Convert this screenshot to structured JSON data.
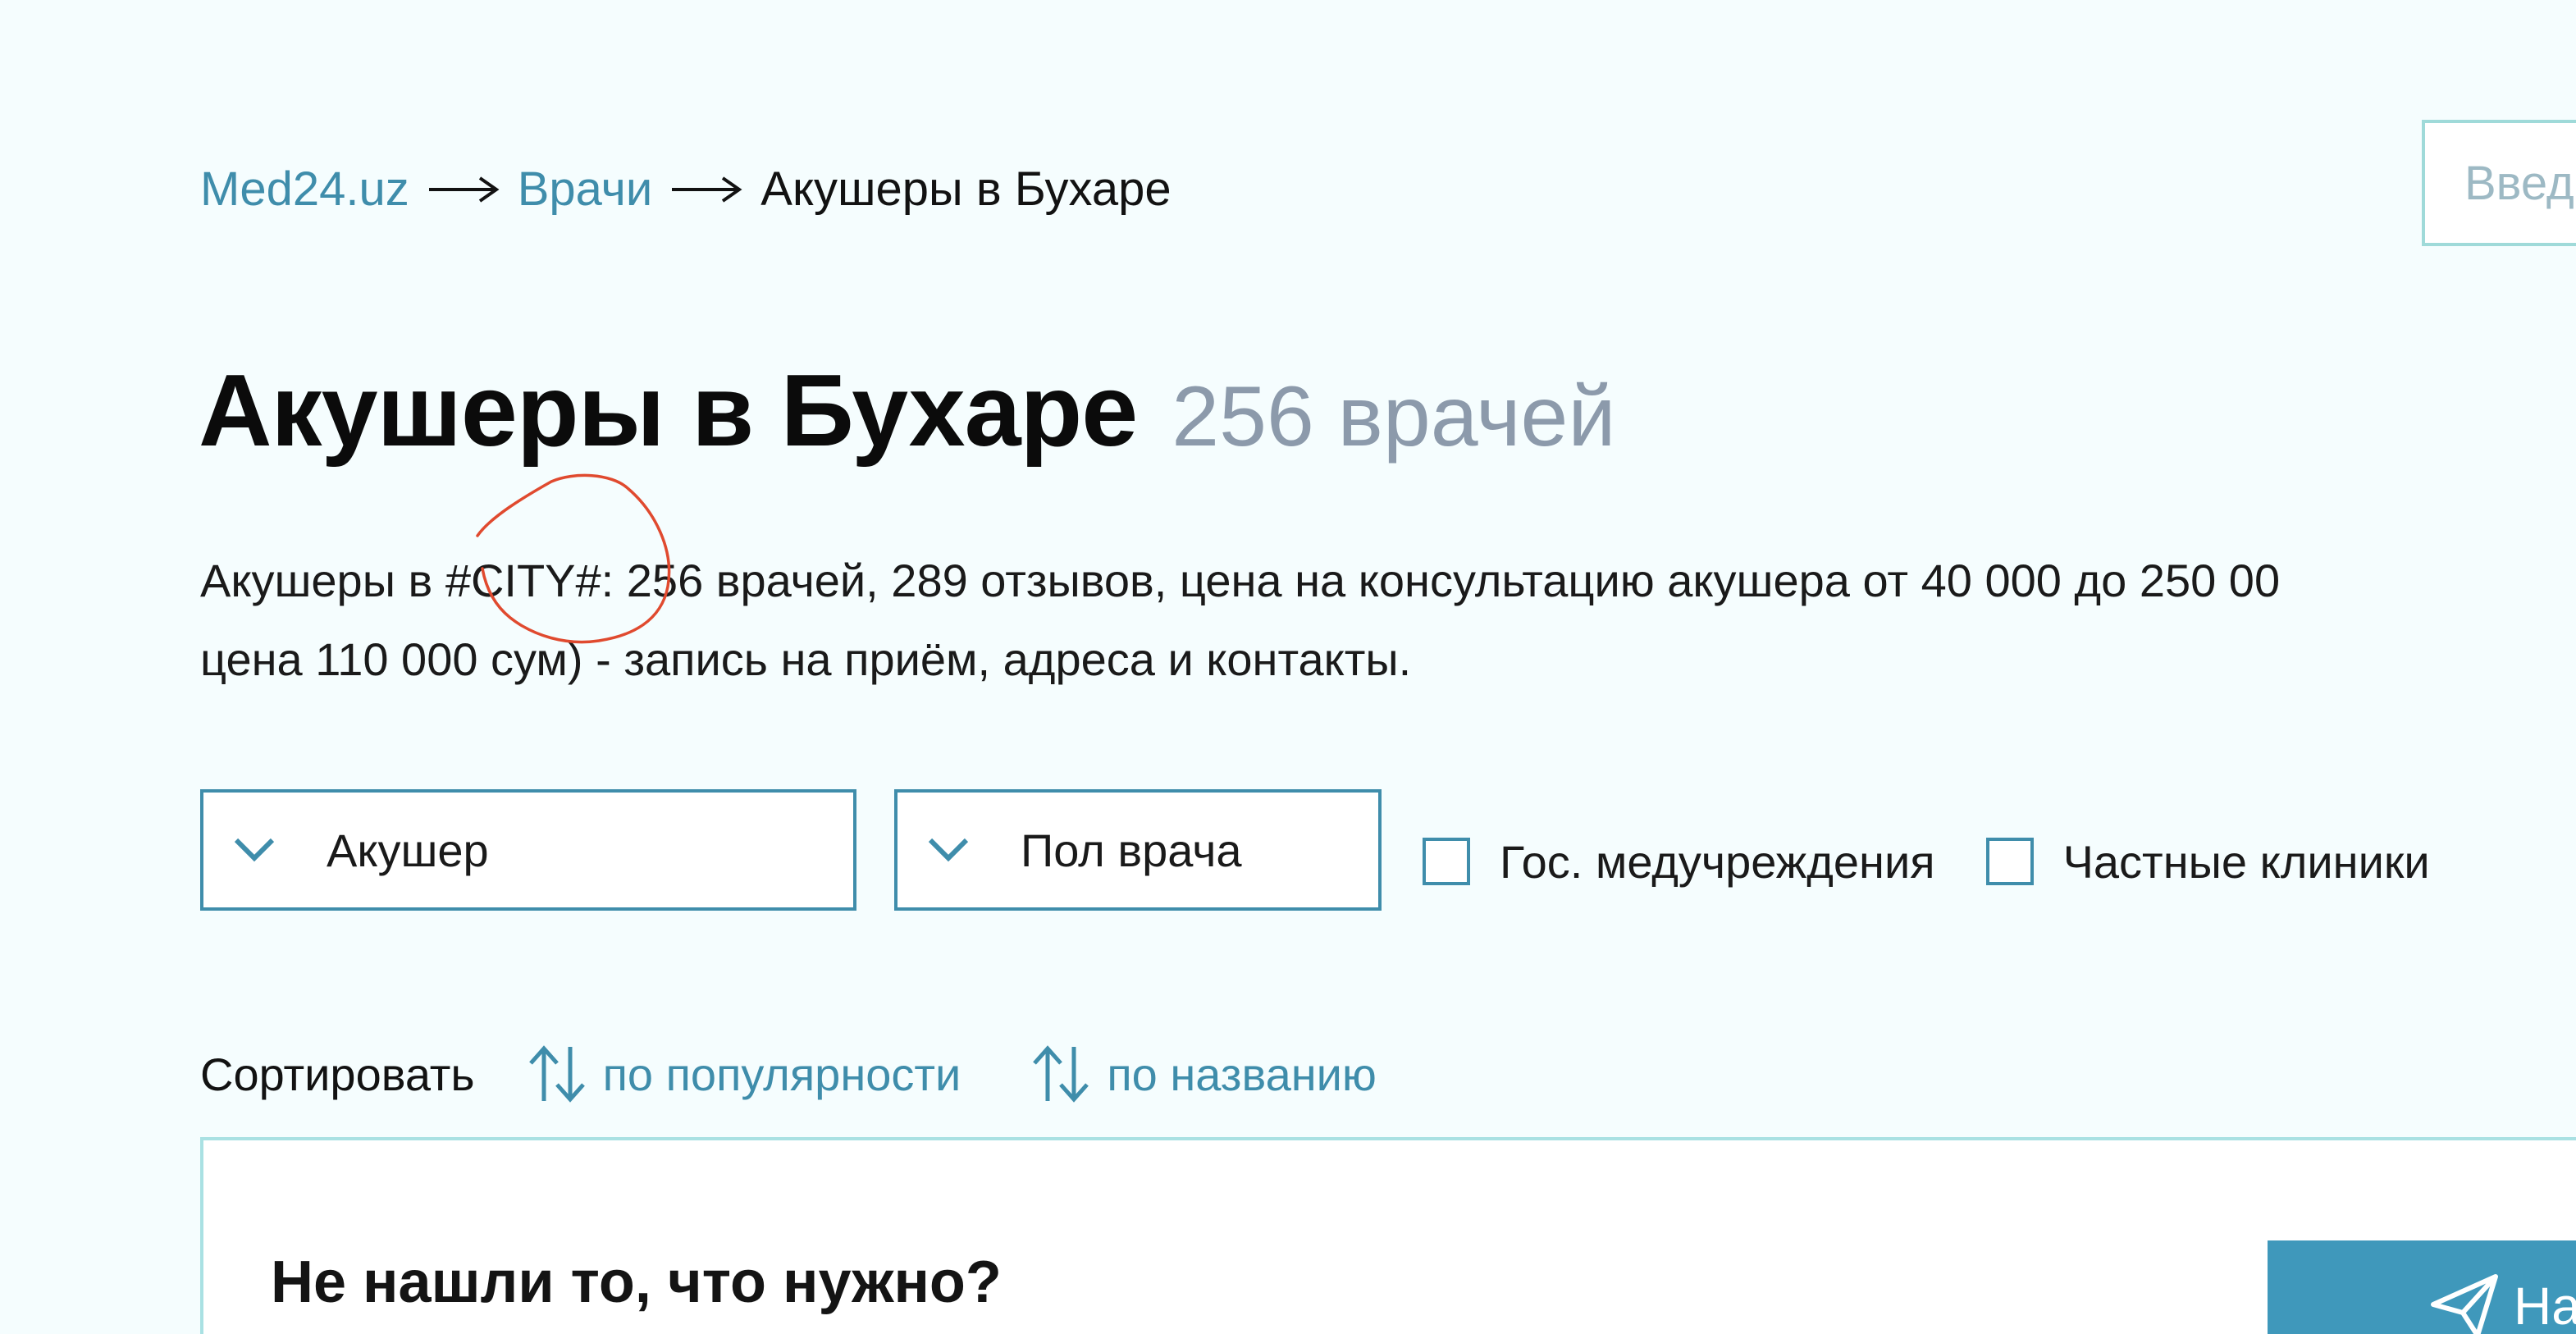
{
  "breadcrumb": {
    "items": [
      {
        "label": "Med24.uz"
      },
      {
        "label": "Врачи"
      },
      {
        "label": "Акушеры в Бухаре"
      }
    ]
  },
  "search": {
    "placeholder": "Введ"
  },
  "page": {
    "title": "Акушеры в Бухаре",
    "count": "256 врачей",
    "description_line1": "Акушеры в #CITY#: 256 врачей, 289 отзывов, цена на консультацию акушера от 40 000 до 250 00",
    "description_line2": "цена 110 000 сум) - запись на приём, адреса и контакты."
  },
  "filters": {
    "specialty": "Акушер",
    "gender": "Пол врача",
    "gov_clinics": "Гос. медучреждения",
    "private_clinics": "Частные клиники"
  },
  "sort": {
    "label": "Сортировать",
    "by_popularity": "по популярности",
    "by_name": "по названию"
  },
  "card": {
    "title": "Не нашли то, что нужно?",
    "button_label": "На"
  },
  "colors": {
    "accent": "#3f8dab",
    "annotation": "#e04a2f",
    "background": "#f5fdfe",
    "count_gray": "#8c9aab"
  },
  "icons": {
    "breadcrumb_separator": "long-arrow-right-icon",
    "dropdown": "chevron-down-icon",
    "sort": "sort-arrows-icon",
    "send": "paper-plane-icon"
  }
}
